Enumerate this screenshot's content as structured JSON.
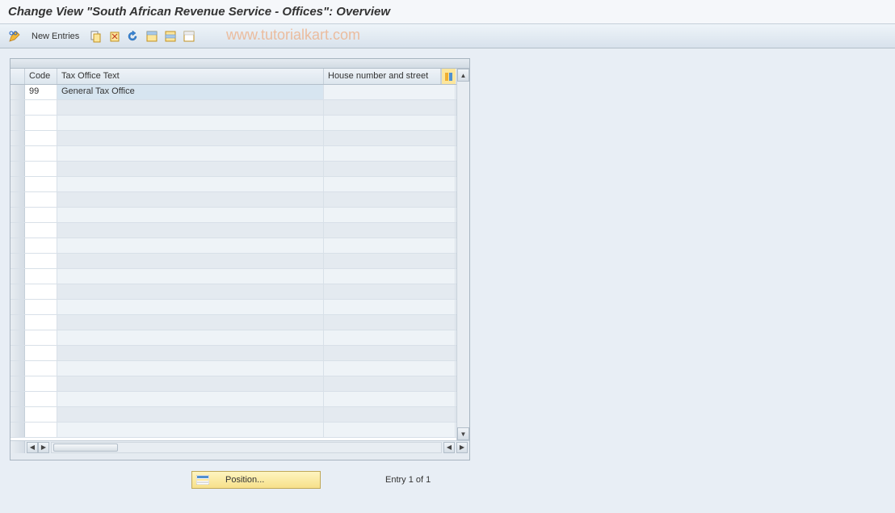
{
  "title": "Change View \"South African Revenue Service - Offices\": Overview",
  "toolbar": {
    "new_entries_label": "New Entries"
  },
  "table": {
    "columns": {
      "code": "Code",
      "text": "Tax Office Text",
      "house": "House number and street"
    },
    "rows": [
      {
        "code": "99",
        "text": "General Tax Office",
        "house": ""
      }
    ]
  },
  "footer": {
    "position_label": "Position...",
    "entry_text": "Entry 1 of 1"
  },
  "watermark": "www.tutorialkart.com"
}
